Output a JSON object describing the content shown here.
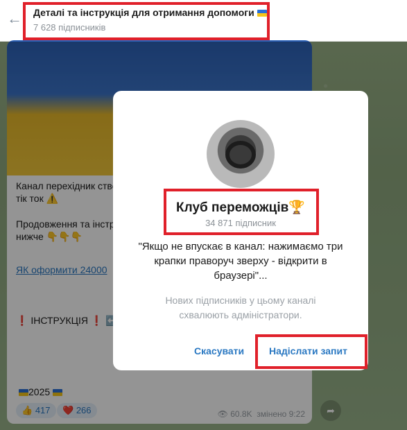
{
  "header": {
    "title": "Деталі та інструкція для отримання допомоги",
    "flag_icon": "ukraine-flag-icon",
    "subscribers": "7 628 підписників"
  },
  "message": {
    "line1": "Канал перехідник ство",
    "line2": "тік ток ⚠️",
    "line3": "Продовження та інстр",
    "line4": "нижче 👇👇👇",
    "link": "ЯК оформити 24000",
    "instruction": "❗ ІНСТРУКЦІЯ ❗ ⬅️",
    "year": "2025",
    "reactions": [
      {
        "emoji": "👍",
        "count": "417"
      },
      {
        "emoji": "❤️",
        "count": "266"
      }
    ],
    "views": "60.8K",
    "edited": "змінено 9:22"
  },
  "modal": {
    "club_name": "Клуб переможців",
    "trophy_icon": "🏆",
    "subscribers": "34 871 підписник",
    "quote": "\"Якщо не впускає в канал: нажимаємо три крапки праворуч зверху - відкрити в браузері\"...",
    "approval_note": "Нових підписників у цьому каналі схвалюють адміністратори.",
    "cancel_label": "Скасувати",
    "send_label": "Надіслати запит"
  },
  "colors": {
    "accent": "#2a78c2",
    "highlight_border": "#e0202a"
  }
}
